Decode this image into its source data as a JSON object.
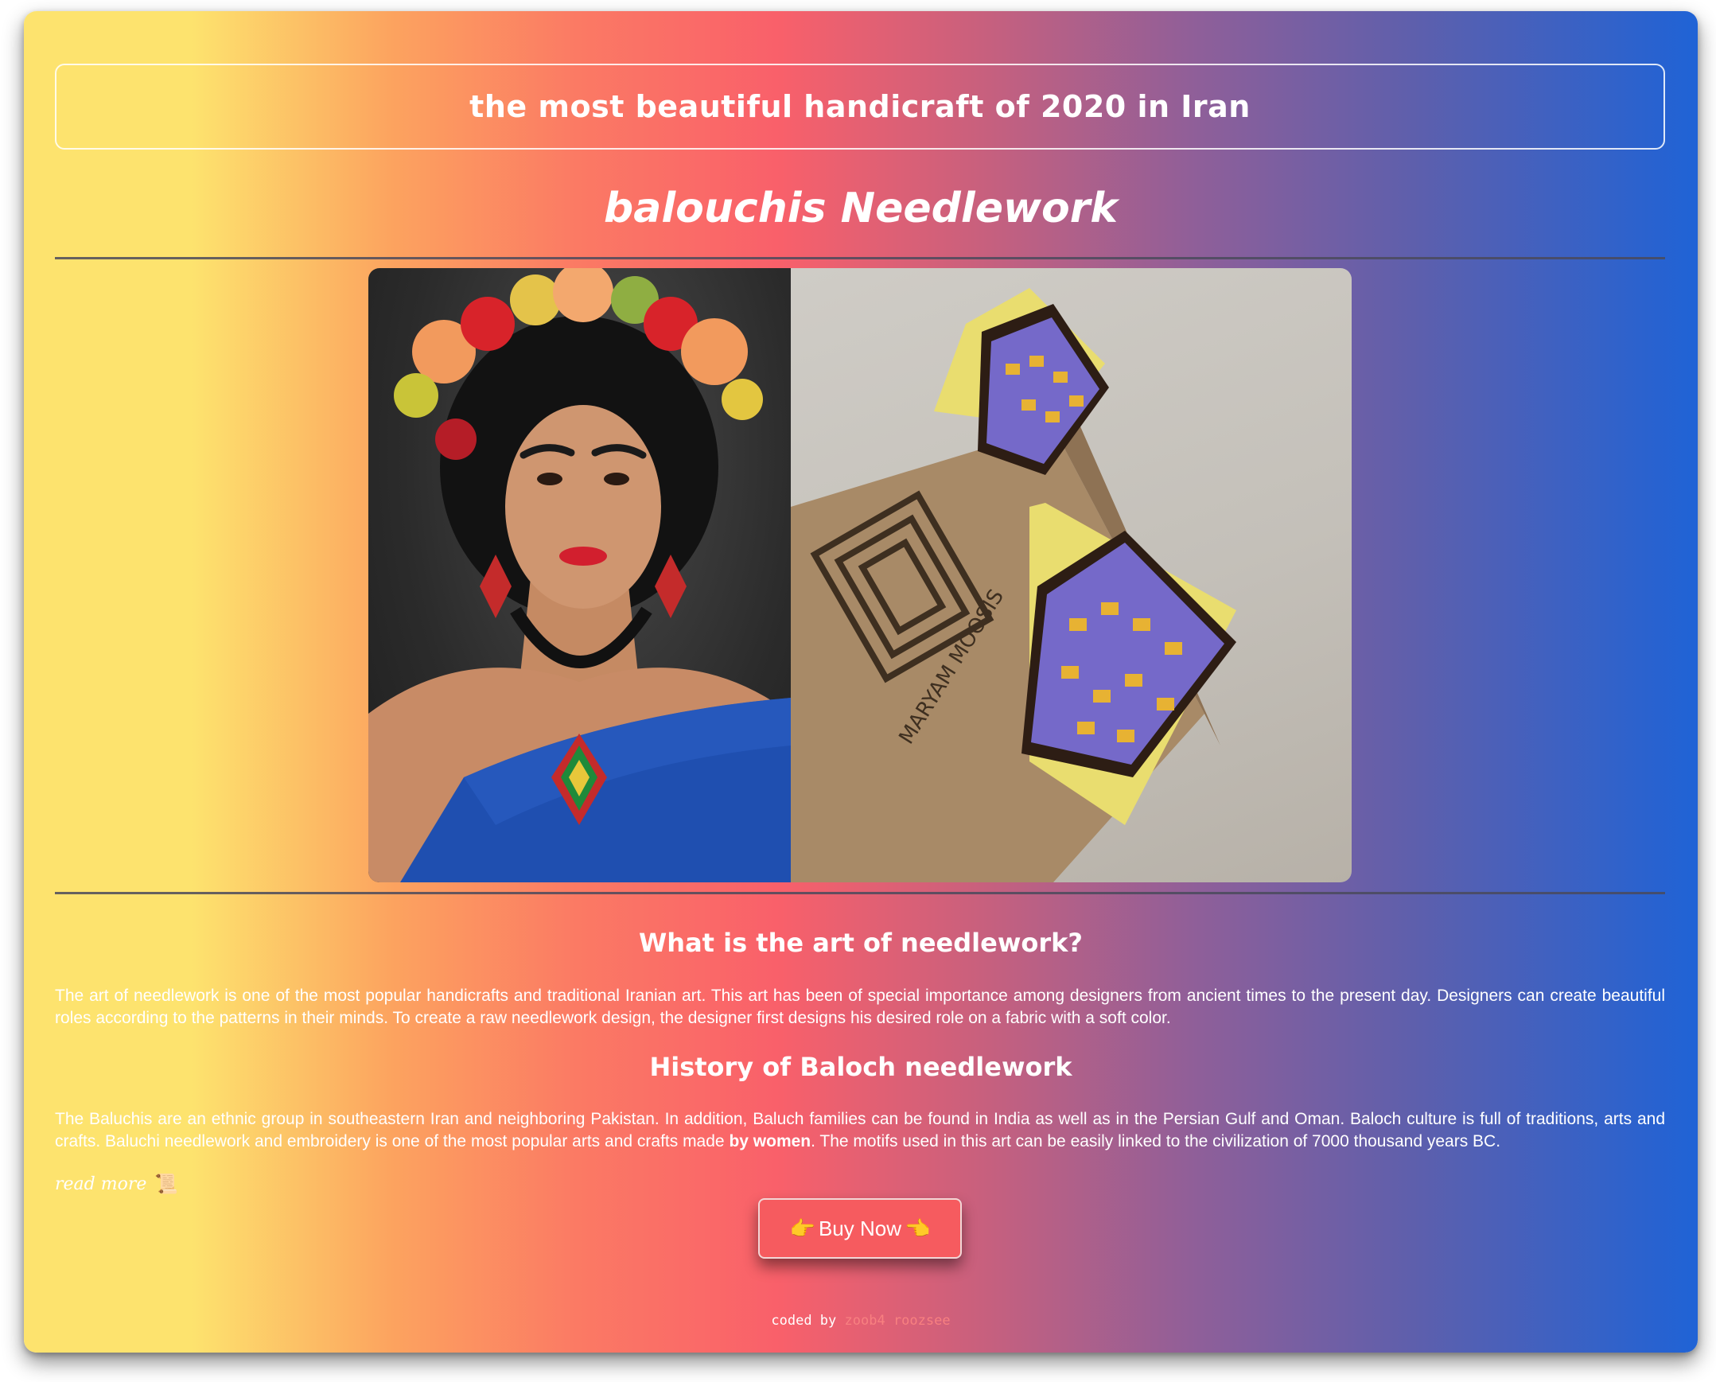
{
  "banner": {
    "title": "the most beautiful handicraft of 2020 in Iran"
  },
  "page": {
    "title": "balouchis Needlework"
  },
  "hero": {
    "box_brand": "MARYAM MOOSIS"
  },
  "section1": {
    "heading": "What is the art of needlework?",
    "text": "The art of needlework is one of the most popular handicrafts and traditional Iranian art. This art has been of special importance among designers from ancient times to the present day. Designers can create beautiful roles according to the patterns in their minds. To create a raw needlework design, the designer first designs his desired role on a fabric with a soft color."
  },
  "section2": {
    "heading": "History of Baloch needlework",
    "text_before": "The Baluchis are an ethnic group in southeastern Iran and neighboring Pakistan. In addition, Baluch families can be found in India as well as in the Persian Gulf and Oman. Baloch culture is full of traditions, arts and crafts. Baluchi needlework and embroidery is one of the most popular arts and crafts made ",
    "text_bold": "by women",
    "text_after": ". The motifs used in this art can be easily linked to the civilization of 7000 thousand years BC."
  },
  "read_more": {
    "label": "read more",
    "icon": "scroll-icon"
  },
  "buy": {
    "label": "Buy Now",
    "left_icon": "pointing-right-hand-icon",
    "right_icon": "pointing-left-hand-icon"
  },
  "footer": {
    "prefix": "coded by",
    "author": "zoob4 roozsee"
  },
  "colors": {
    "gradient_start": "#fde36e",
    "gradient_mid": "#f9606a",
    "gradient_end": "#1f63d6",
    "button": "#f65b5f",
    "author_link": "#f88080"
  }
}
